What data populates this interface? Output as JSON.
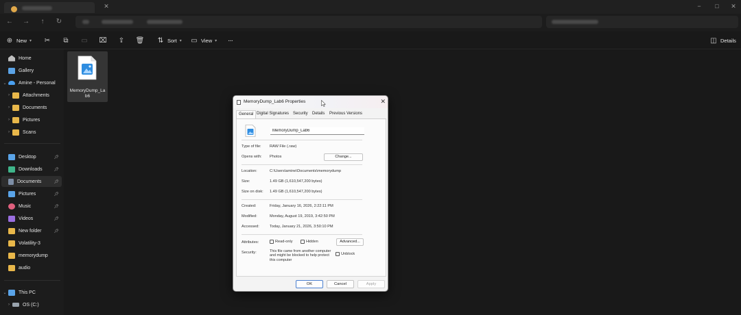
{
  "titlebar": {
    "tab_title": "",
    "window_controls": [
      "−",
      "□",
      "✕"
    ]
  },
  "addressbar": {
    "path": "",
    "search_placeholder": ""
  },
  "command_bar": {
    "new_label": "New",
    "sort_label": "Sort",
    "view_label": "View",
    "more_label": "···",
    "details_label": "Details"
  },
  "sidebar": {
    "items": [
      {
        "label": "Home",
        "icon": "home-icon",
        "color": "#bfbfbf"
      },
      {
        "label": "Gallery",
        "icon": "gallery-icon",
        "color": "#5ba3e6"
      },
      {
        "label": "Amine - Personal",
        "icon": "cloud-icon",
        "color": "#4aa0f0"
      },
      {
        "label": "Attachments",
        "icon": "folder-icon",
        "color": "#e8b74a"
      },
      {
        "label": "Documents",
        "icon": "folder-icon",
        "color": "#e8b74a"
      },
      {
        "label": "Pictures",
        "icon": "folder-icon",
        "color": "#e8b74a"
      },
      {
        "label": "Scans",
        "icon": "folder-icon",
        "color": "#e8b74a"
      },
      {
        "label": "Desktop",
        "icon": "desktop-icon",
        "color": "#5aa4e8"
      },
      {
        "label": "Downloads",
        "icon": "downloads-icon",
        "color": "#3fb58a"
      },
      {
        "label": "Documents",
        "icon": "documents-icon",
        "color": "#7d8ea6"
      },
      {
        "label": "Pictures",
        "icon": "pictures-icon",
        "color": "#5aa4e8"
      },
      {
        "label": "Music",
        "icon": "music-icon",
        "color": "#e0607e"
      },
      {
        "label": "Videos",
        "icon": "videos-icon",
        "color": "#9a6ee0"
      },
      {
        "label": "New folder",
        "icon": "folder-icon",
        "color": "#e8b74a"
      },
      {
        "label": "Volatility-3",
        "icon": "folder-icon",
        "color": "#e8b74a"
      },
      {
        "label": "memorydump",
        "icon": "folder-icon",
        "color": "#e8b74a"
      },
      {
        "label": "audio",
        "icon": "folder-icon",
        "color": "#e8b74a"
      },
      {
        "label": "This PC",
        "icon": "pc-icon",
        "color": "#5aa4e8"
      },
      {
        "label": "OS (C:)",
        "icon": "drive-icon",
        "color": "#9aa4ae"
      }
    ]
  },
  "file": {
    "name": "MemoryDump_Lab6",
    "icon": "image-file-icon"
  },
  "dialog": {
    "title": "MemoryDump_Lab6 Properties",
    "tabs": [
      "General",
      "Digital Signatures",
      "Security",
      "Details",
      "Previous Versions"
    ],
    "active_tab": "General",
    "name_value": "MemoryDump_Lab6",
    "type_label": "Type of file:",
    "type_value": "RAW File (.raw)",
    "opens_label": "Opens with:",
    "opens_value": "Photos",
    "change_button": "Change...",
    "location_label": "Location:",
    "location_value": "C:\\Users\\amine\\Documents\\memorydump",
    "size_label": "Size:",
    "size_value": "1.49 GB (1,610,547,200 bytes)",
    "size_disk_label": "Size on disk:",
    "size_disk_value": "1.49 GB (1,610,547,200 bytes)",
    "created_label": "Created:",
    "created_value": "Friday, January 16, 2026, 2:22:11 PM",
    "modified_label": "Modified:",
    "modified_value": "Monday, August 19, 2019, 3:42:50 PM",
    "accessed_label": "Accessed:",
    "accessed_value": "Today, January 21, 2026, 3:50:10 PM",
    "attributes_label": "Attributes:",
    "readonly_label": "Read-only",
    "hidden_label": "Hidden",
    "advanced_button": "Advanced...",
    "security_label": "Security:",
    "security_text": "This file came from another computer and might be blocked to help protect this computer",
    "unblock_label": "Unblock",
    "ok_button": "OK",
    "cancel_button": "Cancel",
    "apply_button": "Apply"
  },
  "colors": {
    "accent": "#4a7fcf",
    "folder": "#e8b74a",
    "background": "#1c1c1c"
  }
}
